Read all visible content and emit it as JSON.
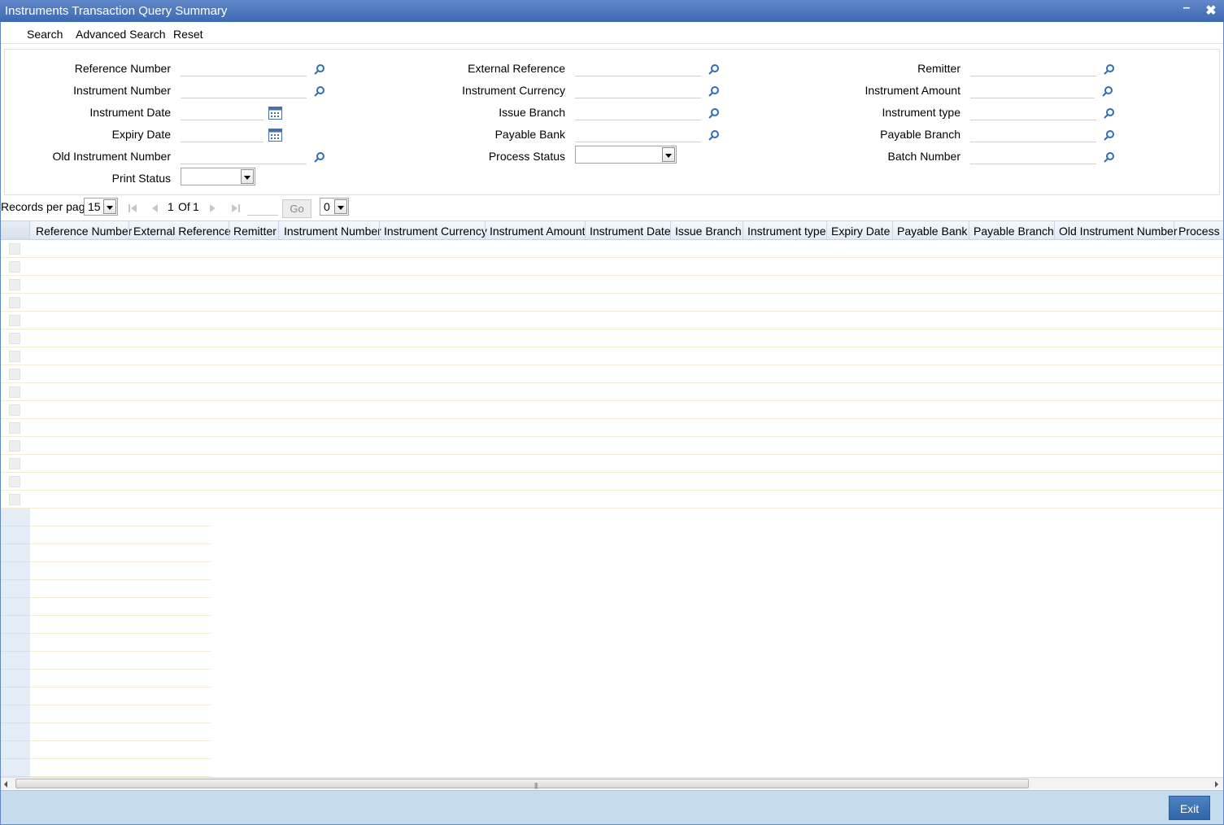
{
  "window": {
    "title": "Instruments Transaction Query Summary",
    "minimize_label": "–",
    "close_label": "✖"
  },
  "toolbar": {
    "search": "Search",
    "advanced_search": "Advanced Search",
    "reset": "Reset"
  },
  "criteria": {
    "reference_number": "Reference Number",
    "instrument_number": "Instrument Number",
    "instrument_date": "Instrument Date",
    "expiry_date": "Expiry Date",
    "old_instrument_number": "Old Instrument Number",
    "print_status": "Print Status",
    "external_reference": "External Reference",
    "instrument_currency": "Instrument Currency",
    "issue_branch": "Issue Branch",
    "payable_bank": "Payable Bank",
    "process_status": "Process Status",
    "remitter": "Remitter",
    "instrument_amount": "Instrument Amount",
    "instrument_type": "Instrument type",
    "payable_branch": "Payable Branch",
    "batch_number": "Batch Number"
  },
  "pager": {
    "records_per_page_label": "Records per page",
    "records_per_page_value": "15",
    "page_current": "1",
    "page_of": "Of",
    "page_total": "1",
    "go_label": "Go",
    "secondary_select_value": "0"
  },
  "grid": {
    "columns": [
      "Reference Number",
      "External Reference",
      "Remitter",
      "Instrument Number",
      "Instrument Currency",
      "Instrument Amount",
      "Instrument Date",
      "Issue Branch",
      "Instrument type",
      "Expiry Date",
      "Payable Bank",
      "Payable Branch",
      "Old Instrument Number",
      "Process S"
    ],
    "row_count": 15,
    "extra_row_count": 15
  },
  "footer": {
    "exit_label": "Exit"
  },
  "colors": {
    "title_bar": "#4a74bd",
    "footer_bg": "#c5dcee",
    "exit_button": "#3c72b6",
    "icon_blue": "#2f6db5"
  },
  "icons": {
    "lookup": "search-lens-icon",
    "calendar": "calendar-icon",
    "pager_first": "first-page-icon",
    "pager_prev": "prev-page-icon",
    "pager_next": "next-page-icon",
    "pager_last": "last-page-icon"
  }
}
